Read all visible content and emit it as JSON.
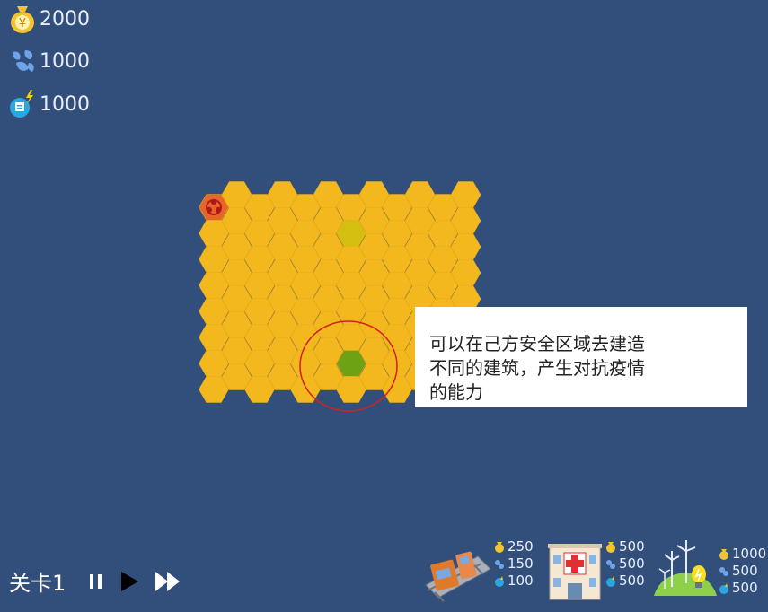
{
  "resources": [
    {
      "icon": "money-bag-icon",
      "value": "2000"
    },
    {
      "icon": "water-drops-icon",
      "value": "1000"
    },
    {
      "icon": "power-plug-icon",
      "value": "1000"
    }
  ],
  "tooltip": {
    "lines": [
      "可以在己方安全区域去建造",
      "不同的建筑，产生对抗疫情",
      "的能力"
    ]
  },
  "level": {
    "label": "关卡1"
  },
  "shop": [
    {
      "name": "factory-building",
      "money": "250",
      "water": "150",
      "power": "100"
    },
    {
      "name": "hospital-building",
      "money": "500",
      "water": "500",
      "power": "500"
    },
    {
      "name": "wind-power-building",
      "money": "1000",
      "water": "500",
      "power": "500"
    }
  ],
  "colors": {
    "background": "#324f7c",
    "hex_tile": "#f2b81e",
    "hex_dark_tile": "#d4be10",
    "hex_selected": "#6ea214",
    "virus_tile": "#e8652a",
    "highlight_ring": "#d42020"
  }
}
